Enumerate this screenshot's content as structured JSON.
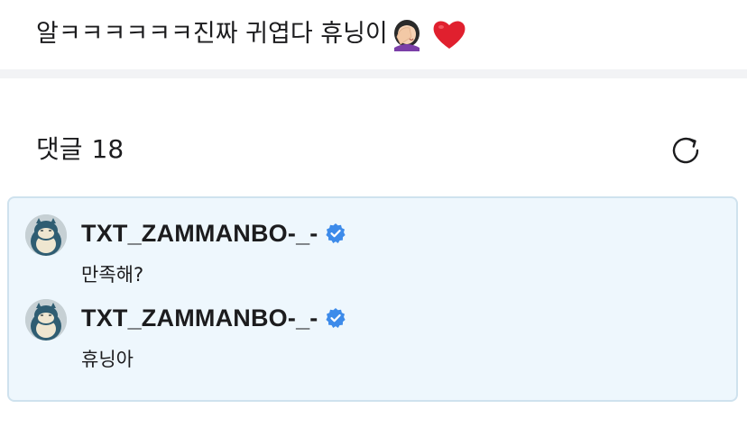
{
  "post": {
    "text": "알ㅋㅋㅋㅋㅋㅋ진짜 귀엽다 휴닝이",
    "emojis": [
      "face-palm-woman-emoji",
      "red-heart-emoji"
    ]
  },
  "comments_section": {
    "label": "댓글",
    "count": "18",
    "refresh_icon": "refresh-icon"
  },
  "thread": {
    "comments": [
      {
        "username": "TXT_ZAMMANBO-_-",
        "verified": true,
        "text": "만족해?"
      },
      {
        "username": "TXT_ZAMMANBO-_-",
        "verified": true,
        "text": "휴닝아"
      }
    ]
  },
  "colors": {
    "thread_background": "#eef7fd",
    "thread_border": "#cfe2ee",
    "verified_badge": "#3d8bea",
    "heart": "#e0202e"
  }
}
